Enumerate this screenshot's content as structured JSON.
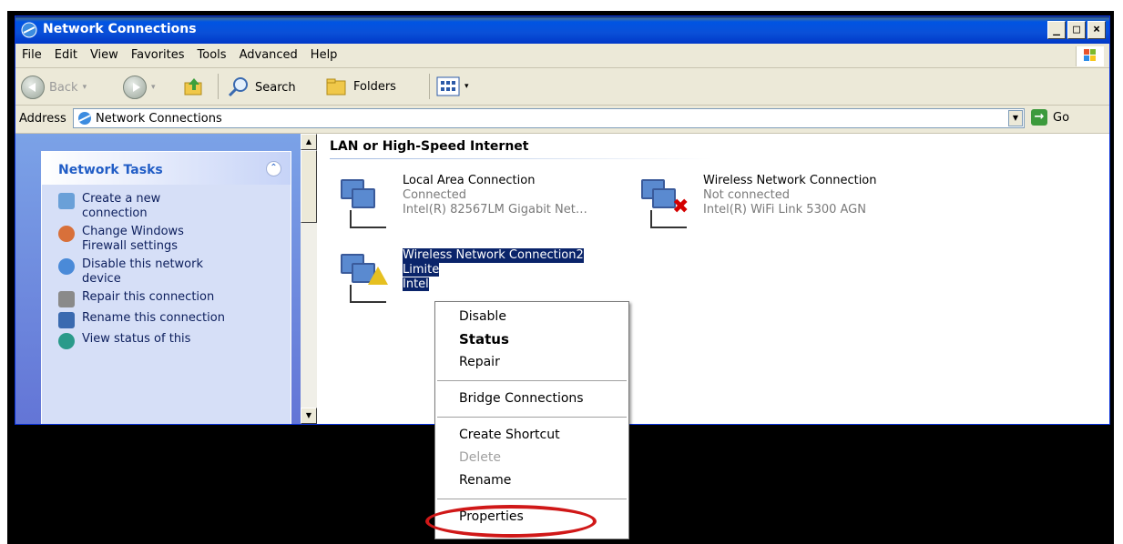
{
  "window": {
    "title": "Network Connections"
  },
  "menu": [
    "File",
    "Edit",
    "View",
    "Favorites",
    "Tools",
    "Advanced",
    "Help"
  ],
  "toolbar": {
    "back": "Back",
    "search": "Search",
    "folders": "Folders"
  },
  "address": {
    "label": "Address",
    "value": "Network Connections",
    "go": "Go"
  },
  "tasks": {
    "title": "Network Tasks",
    "items": [
      {
        "label": "Create a new connection",
        "icon": "new-connection-icon"
      },
      {
        "label": "Change Windows Firewall settings",
        "icon": "firewall-icon"
      },
      {
        "label": "Disable this network device",
        "icon": "disable-network-icon"
      },
      {
        "label": "Repair this connection",
        "icon": "repair-icon"
      },
      {
        "label": "Rename this connection",
        "icon": "rename-icon"
      },
      {
        "label": "View status of this",
        "icon": "view-status-icon"
      }
    ]
  },
  "group": {
    "title": "LAN or High-Speed Internet"
  },
  "connections": [
    {
      "name": "Local Area Connection",
      "status": "Connected",
      "device": "Intel(R) 82567LM Gigabit Net…"
    },
    {
      "name": "Wireless Network Connection",
      "status": "Not connected",
      "device": "Intel(R) WiFi Link 5300 AGN"
    },
    {
      "name": "Wireless Network Connection2",
      "status": "Limite",
      "device": "Intel"
    }
  ],
  "context_menu": {
    "items": [
      {
        "label": "Disable"
      },
      {
        "label": "Status",
        "bold": true
      },
      {
        "label": "Repair"
      },
      {
        "label": "Bridge Connections"
      },
      {
        "label": "Create Shortcut"
      },
      {
        "label": "Delete",
        "disabled": true
      },
      {
        "label": "Rename"
      },
      {
        "label": "Properties",
        "highlighted": true
      }
    ]
  },
  "colors": {
    "titlebar": "#0054e3",
    "selection": "#0a246a",
    "highlight_ring": "#d01818"
  }
}
